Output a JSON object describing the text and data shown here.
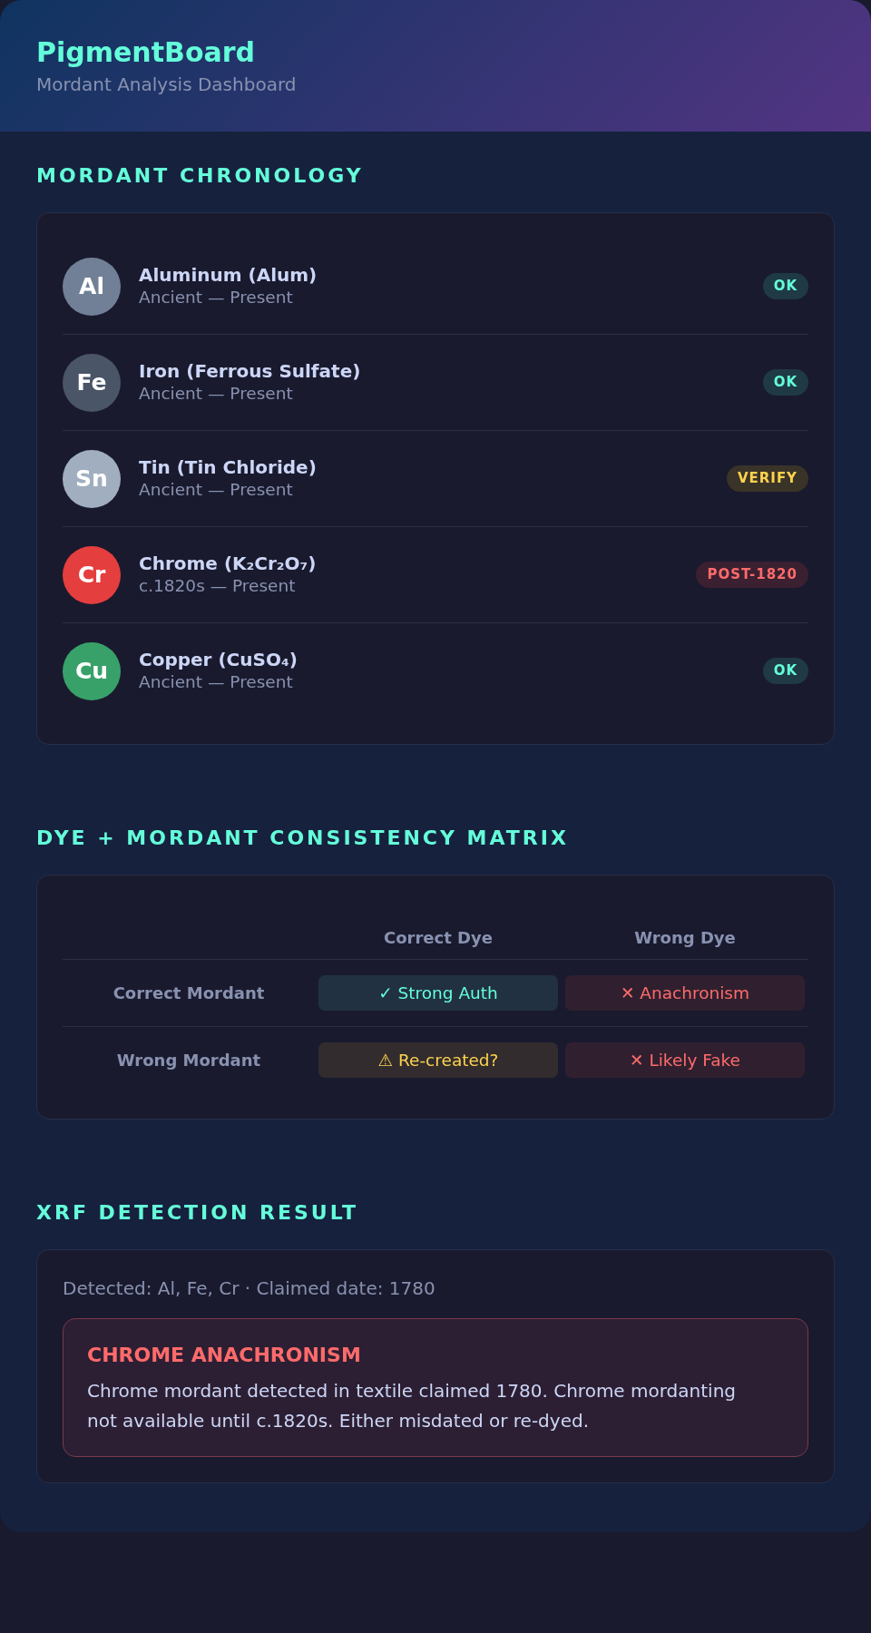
{
  "header": {
    "title": "PigmentBoard",
    "subtitle": "Mordant Analysis Dashboard"
  },
  "chronology": {
    "title": "MORDANT CHRONOLOGY",
    "mordants": [
      {
        "symbol": "Al",
        "color": "#718096",
        "name": "Aluminum (Alum)",
        "period": "Ancient — Present",
        "badge": {
          "label": "OK",
          "kind": "ok"
        }
      },
      {
        "symbol": "Fe",
        "color": "#4a5568",
        "name": "Iron (Ferrous Sulfate)",
        "period": "Ancient — Present",
        "badge": {
          "label": "OK",
          "kind": "ok"
        }
      },
      {
        "symbol": "Sn",
        "color": "#a0aec0",
        "name": "Tin (Tin Chloride)",
        "period": "Ancient — Present",
        "badge": {
          "label": "VERIFY",
          "kind": "warn"
        }
      },
      {
        "symbol": "Cr",
        "color": "#e53e3e",
        "name": "Chrome (K₂Cr₂O₇)",
        "period": "c.1820s — Present",
        "badge": {
          "label": "POST-1820",
          "kind": "danger"
        }
      },
      {
        "symbol": "Cu",
        "color": "#38a169",
        "name": "Copper (CuSO₄)",
        "period": "Ancient — Present",
        "badge": {
          "label": "OK",
          "kind": "ok"
        }
      }
    ]
  },
  "matrix": {
    "title": "DYE + MORDANT CONSISTENCY MATRIX",
    "columns": [
      "Correct Dye",
      "Wrong Dye"
    ],
    "rows": [
      {
        "label": "Correct Mordant",
        "cells": [
          {
            "text": "✓ Strong Auth",
            "kind": "ok"
          },
          {
            "text": "✕ Anachronism",
            "kind": "danger"
          }
        ]
      },
      {
        "label": "Wrong Mordant",
        "cells": [
          {
            "text": "⚠ Re-created?",
            "kind": "warn"
          },
          {
            "text": "✕ Likely Fake",
            "kind": "danger"
          }
        ]
      }
    ]
  },
  "xrf": {
    "title": "XRF DETECTION RESULT",
    "summary": "Detected: Al, Fe, Cr · Claimed date: 1780",
    "alert": {
      "title": "CHROME ANACHRONISM",
      "body": "Chrome mordant detected in textile claimed 1780. Chrome mordanting not available until c.1820s. Either misdated or re-dyed.",
      "kind": "danger"
    }
  }
}
